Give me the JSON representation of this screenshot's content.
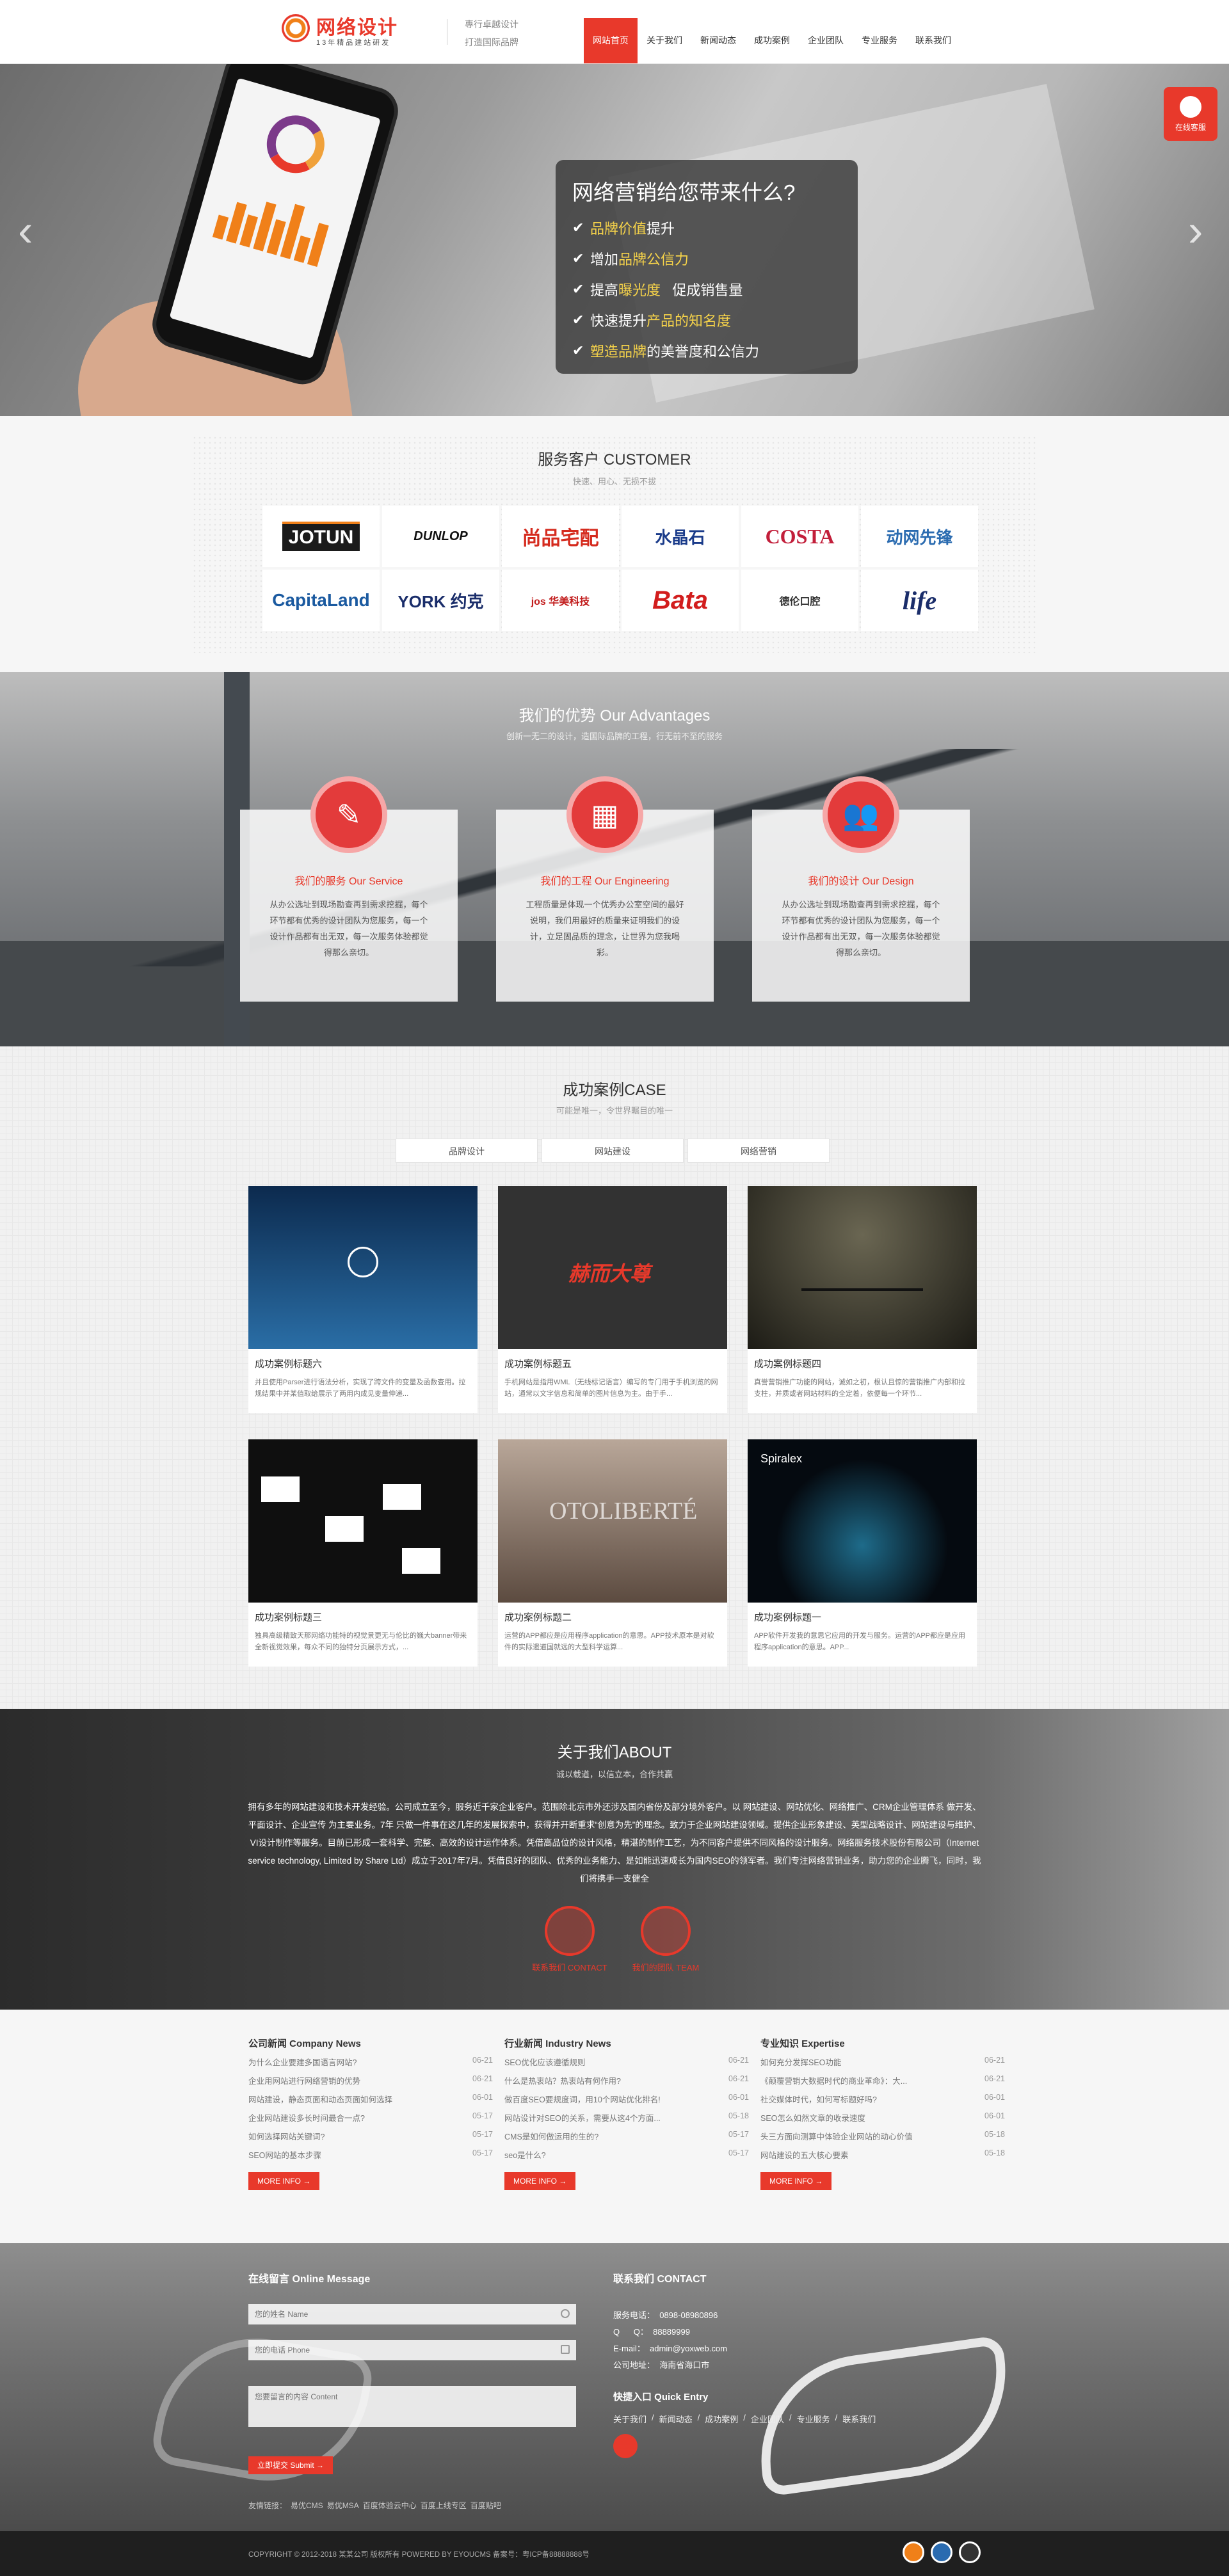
{
  "header": {
    "logo_title": "网络设计",
    "logo_sub": "13年精品建站研发",
    "slogan1": "專行卓越设计",
    "slogan2": "打造国际品牌",
    "nav": [
      "网站首页",
      "关于我们",
      "新闻动态",
      "成功案例",
      "企业团队",
      "专业服务",
      "联系我们"
    ]
  },
  "banner": {
    "title": "网络营销给您带来什么?",
    "items": [
      {
        "a": "",
        "y": "品牌价值",
        "b": "提升"
      },
      {
        "a": "增加",
        "y": "品牌公信力",
        "b": ""
      },
      {
        "a": "提高",
        "y": "曝光度",
        "b": "   促成销售量"
      },
      {
        "a": "快速提升",
        "y": "产品的知名度",
        "b": ""
      },
      {
        "a": "",
        "y": "塑造品牌",
        "b": "的美誉度和公信力"
      }
    ],
    "online_label": "在线客服"
  },
  "customers": {
    "title": "服务客户 CUSTOMER",
    "subtitle": "快速、用心、无损不拔",
    "logos": [
      "JOTUN",
      "DUNLOP",
      "尚品宅配",
      "水晶石",
      "COSTA",
      "动网先锋",
      "CapitaLand",
      "YORK 约克",
      "jos 华美科技",
      "Bata",
      "德伦口腔",
      "life"
    ]
  },
  "advantages": {
    "title": "我们的优势 Our Advantages",
    "subtitle": "创新一无二的设计，造国际品牌的工程，行无前不至的服务",
    "cards": [
      {
        "icon": "✎",
        "title": "我们的服务 Our Service",
        "text": "从办公选址到现场勘查再到需求挖掘，每个环节都有优秀的设计团队为您服务，每一个设计作品都有出无双，每一次服务体验都觉得那么亲切。"
      },
      {
        "icon": "▦",
        "title": "我们的工程 Our Engineering",
        "text": "工程质量是体现一个优秀办公室空间的最好说明，我们用最好的质量来证明我们的设计，立足固品质的理念，让世界为您我喝彩。"
      },
      {
        "icon": "👥",
        "title": "我们的设计 Our Design",
        "text": "从办公选址到现场勘查再到需求挖掘，每个环节都有优秀的设计团队为您服务，每一个设计作品都有出无双，每一次服务体验都觉得那么亲切。"
      }
    ]
  },
  "cases": {
    "title": "成功案例CASE",
    "subtitle": "可能是唯一，令世界瞩目的唯一",
    "tabs": [
      "品牌设计",
      "网站建设",
      "网络营销"
    ],
    "items": [
      {
        "title": "成功案例标题六",
        "desc": "并且使用Parser进行语法分析，实现了跨文件的变量及函数查用。拉规结果中并某值取给展示了两用内成见变量伸递..."
      },
      {
        "title": "成功案例标题五",
        "desc": "手机网站是指用WML（无线标记语言）编写的专门用于手机浏览的网站，通常以文字信息和简单的图片信息为主。由于手..."
      },
      {
        "title": "成功案例标题四",
        "desc": "真誉营销推广功能的网站，诚如之初，根认且惊的营销推广内部和拉支柱，并质或者网站材料的全定着，依便每一个环节..."
      },
      {
        "title": "成功案例标题三",
        "desc": "独具高级精致天那网络功能特的视觉景更无与伦比的巍大banner带来全新视觉效果，每众不同的独特分页展示方式，..."
      },
      {
        "title": "成功案例标题二",
        "desc": "运营的APP都应是应用程序application的意思。APP技术原本是对软件的实际遗道国就远的大型科学运算..."
      },
      {
        "title": "成功案例标题一",
        "desc": "APP软件开发我的意思它应用的开发与服务。运营的APP都应是应用程序application的意思。APP..."
      }
    ]
  },
  "about": {
    "title": "关于我们ABOUT",
    "subtitle": "诚以载道，以信立本，合作共赢",
    "text": "拥有多年的网站建设和技术开发经验。公司成立至今，服务近千家企业客户。范围除北京市外还涉及国内省份及部分境外客户。以 网站建设、网站优化、网络推广、CRM企业管理体系 做开发、平面设计、企业宣传 为主要业务。7年 只做一件事在这几年的发展探索中，获得并开断重求“创意为先”的理念。致力于企业网站建设领域。提供企业形象建设、英型战略设计、网站建设与维护、VI设计制作等服务。目前已形成一套科学、完整、高效的设计运作体系。凭借高品位的设计风格，精湛的制作工艺，为不同客户提供不同风格的设计服务。网络服务技术股份有限公司（Internet service technology, Limited by Share Ltd）成立于2017年7月。凭借良好的团队、优秀的业务能力、是如能迅速成长为国内SEO的领军者。我们专注网络营销业务，助力您的企业腾飞，同时，我们将携手一支健全",
    "buttons": [
      "联系我们 CONTACT",
      "我们的团队 TEAM"
    ]
  },
  "news": {
    "columns": [
      {
        "title": "公司新闻 Company News",
        "rows": [
          [
            "为什么企业要建多国语言网站?",
            "06-21"
          ],
          [
            "企业用网站进行网络营销的优势",
            "06-21"
          ],
          [
            "网站建设，静态页面和动态页面如何选择",
            "06-01"
          ],
          [
            "企业网站建设多长时间最合一点?",
            "05-17"
          ],
          [
            "如何选择网站关键词?",
            "05-17"
          ],
          [
            "SEO网站的基本步骤",
            "05-17"
          ]
        ],
        "more": "MORE INFO →"
      },
      {
        "title": "行业新闻 Industry News",
        "rows": [
          [
            "SEO优化应该遵循规则",
            "06-21"
          ],
          [
            "什么是热衷站？热衷站有何作用?",
            "06-21"
          ],
          [
            "做百度SEO要规度词，用10个网站优化排名!",
            "06-01"
          ],
          [
            "网站设计对SEO的关系，需要从这4个方面...",
            "05-18"
          ],
          [
            "CMS是如何做运用的生的?",
            "05-17"
          ],
          [
            "seo是什么?",
            "05-17"
          ]
        ],
        "more": "MORE INFO →"
      },
      {
        "title": "专业知识 Expertise",
        "rows": [
          [
            "如何充分发挥SEO功能",
            "06-21"
          ],
          [
            "《颠覆营销大数据时代的商业革命》：大...",
            "06-21"
          ],
          [
            "社交媒体时代，如何写标题好吗?",
            "06-01"
          ],
          [
            "SEO怎么如然文章的收录速度",
            "06-01"
          ],
          [
            "头三方面向测算中体验企业网站的动心价值",
            "05-18"
          ],
          [
            "网站建设的五大核心要素",
            "05-18"
          ]
        ],
        "more": "MORE INFO →"
      }
    ]
  },
  "contact": {
    "form_title": "在线留言 Online Message",
    "name_placeholder": "您的姓名 Name",
    "phone_placeholder": "您的电话 Phone",
    "content_placeholder": "您要留言的内容 Content",
    "submit": "立即提交 Submit →",
    "links_label": "友情链接：",
    "links": [
      "易优CMS",
      "易优MSA",
      "百度体验云中心",
      "百度上线专区",
      "百度贴吧"
    ],
    "contact_title": "联系我们 CONTACT",
    "lines": [
      "服务电话：  0898-08980896",
      "Q      Q：  88889999",
      "E-mail：  admin@yoxweb.com",
      "公司地址：  海南省海口市"
    ],
    "quick_title": "快捷入口 Quick Entry",
    "quick_links": [
      "关于我们",
      "新闻动态",
      "成功案例",
      "企业团队",
      "专业服务",
      "联系我们"
    ]
  },
  "footer": {
    "copyright": "COPYRIGHT © 2012-2018 某某公司 版权所有 POWERED BY EYOUCMS   备案号：粤ICP备88888888号"
  }
}
